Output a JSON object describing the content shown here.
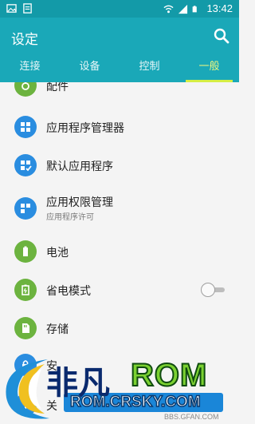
{
  "status_bar": {
    "time": "13:42",
    "left_icons": [
      "image-icon",
      "document-icon"
    ],
    "right_icons": [
      "wifi-icon",
      "signal-icon",
      "battery-icon"
    ]
  },
  "header": {
    "title": "设定",
    "search_icon": "search-icon"
  },
  "tabs": [
    {
      "label": "连接",
      "active": false
    },
    {
      "label": "设备",
      "active": false
    },
    {
      "label": "控制",
      "active": false
    },
    {
      "label": "一般",
      "active": true
    }
  ],
  "list": {
    "items": [
      {
        "label": "配件",
        "icon": "accessory-icon",
        "color": "green"
      },
      {
        "label": "应用程序管理器",
        "icon": "apps-grid-icon",
        "color": "blue"
      },
      {
        "label": "默认应用程序",
        "icon": "default-apps-icon",
        "color": "blue"
      },
      {
        "label": "应用权限管理",
        "sublabel": "应用程序许可",
        "icon": "permissions-icon",
        "color": "blue"
      },
      {
        "label": "电池",
        "icon": "battery-item-icon",
        "color": "green"
      },
      {
        "label": "省电模式",
        "icon": "power-saving-icon",
        "color": "green",
        "toggle": false
      },
      {
        "label": "存储",
        "icon": "storage-icon",
        "color": "green"
      },
      {
        "label": "安",
        "icon": "security-icon",
        "color": "blue"
      },
      {
        "label": "关",
        "icon": "about-icon",
        "color": "blue"
      }
    ]
  },
  "watermark": {
    "brand_cn": "非凡",
    "brand": "ROM",
    "url": "ROM.CRSKY.COM",
    "sub_url": "BBS.GFAN.COM"
  },
  "colors": {
    "status_bar": "#139aa8",
    "action_bar": "#1aa8b8",
    "tab_indicator": "#d5ee44",
    "icon_blue": "#2a8de0",
    "icon_green": "#6cb33f",
    "background": "#f4f4f4"
  }
}
